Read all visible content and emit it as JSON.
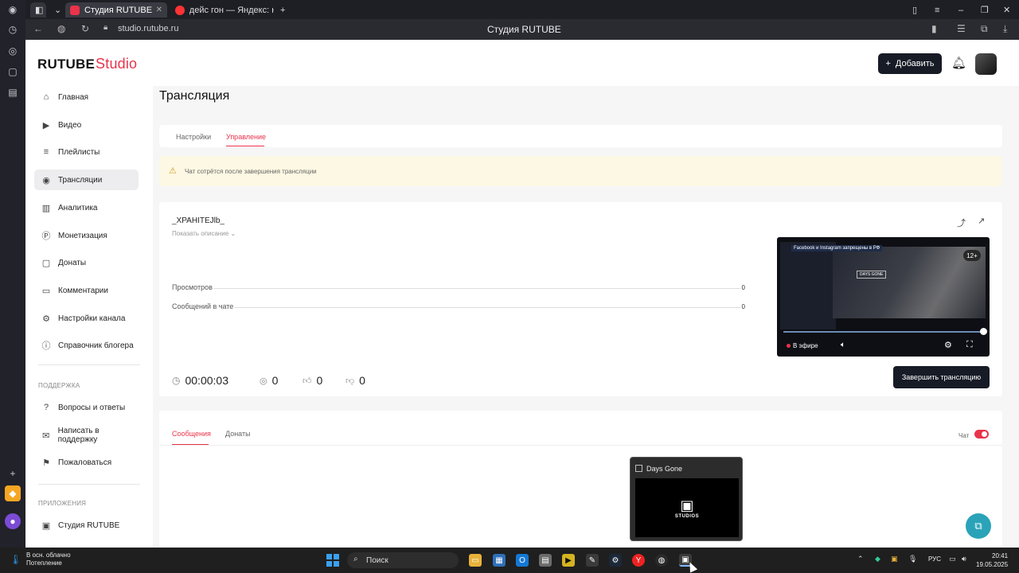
{
  "browser": {
    "tabs": [
      {
        "label": "Студия RUTUBE",
        "favicon_color": "#e8334a"
      },
      {
        "label": "дейс гон — Яндекс: нашл",
        "favicon_color": "#f33"
      }
    ],
    "new_tab": "+",
    "url": "studio.rutube.ru",
    "window_title": "Студия RUTUBE"
  },
  "header": {
    "logo_main": "RUTUBE",
    "logo_sub": "Studio",
    "add_label": "Добавить"
  },
  "sidebar": {
    "items": [
      {
        "label": "Главная",
        "icon": "home-icon",
        "glyph": "⌂"
      },
      {
        "label": "Видео",
        "icon": "video-icon",
        "glyph": "▶"
      },
      {
        "label": "Плейлисты",
        "icon": "playlist-icon",
        "glyph": "≡"
      },
      {
        "label": "Трансляции",
        "icon": "broadcast-icon",
        "glyph": "◉"
      },
      {
        "label": "Аналитика",
        "icon": "analytics-icon",
        "glyph": "▥"
      },
      {
        "label": "Монетизация",
        "icon": "monetization-icon",
        "glyph": "Ⓟ"
      },
      {
        "label": "Донаты",
        "icon": "donate-icon",
        "glyph": "▢"
      },
      {
        "label": "Комментарии",
        "icon": "comment-icon",
        "glyph": "▭"
      },
      {
        "label": "Настройки канала",
        "icon": "settings-icon",
        "glyph": "⚙"
      },
      {
        "label": "Справочник блогера",
        "icon": "info-icon",
        "glyph": "ⓘ"
      }
    ],
    "support_section": "ПОДДЕРЖКА",
    "support_items": [
      {
        "label": "Вопросы и ответы",
        "icon": "question-icon",
        "glyph": "?"
      },
      {
        "label": "Написать в поддержку",
        "icon": "mail-icon",
        "glyph": "✉"
      },
      {
        "label": "Пожаловаться",
        "icon": "flag-icon",
        "glyph": "⚑"
      }
    ],
    "apps_section": "ПРИЛОЖЕНИЯ",
    "app_items": [
      {
        "label": "Студия RUTUBE",
        "icon": "studio-app-icon",
        "glyph": "▣"
      }
    ]
  },
  "main": {
    "page_title": "Трансляция",
    "tabs": [
      {
        "label": "Настройки"
      },
      {
        "label": "Управление"
      }
    ],
    "notice": "Чат сотрётся после завершения трансляции",
    "stream": {
      "name": "_XPAHITEJlb_",
      "show_description": "Показать описание ⌄",
      "stats": [
        {
          "label": "Просмотров",
          "value": "0"
        },
        {
          "label": "Сообщений в чате",
          "value": "0"
        }
      ],
      "timer": "00:00:03",
      "viewers": "0",
      "likes": "0",
      "dislikes": "0",
      "end_label": "Завершить трансляцию"
    },
    "player": {
      "banner": "Facebook и Instagram запрещены в РФ",
      "game_label": "DAYS GONE",
      "age": "12+",
      "live_label": "В эфире",
      "progress": 1.0
    },
    "chat_tabs": [
      {
        "label": "Сообщения"
      },
      {
        "label": "Донаты"
      }
    ],
    "chat_toggle_label": "Чат",
    "chat_enabled": true
  },
  "thumbnail": {
    "title": "Days Gone",
    "studio_text": "STUDIOS"
  },
  "taskbar": {
    "weather_line1": "В осн. облачно",
    "weather_line2": "Потепление",
    "search": "Поиск",
    "lang": "РУС",
    "time": "20:41",
    "date": "19.05.2025"
  },
  "colors": {
    "accent": "#e8334a",
    "dark_button": "#171b26",
    "notice_bg": "#fdf8e3",
    "fab": "#2aa3b8"
  }
}
